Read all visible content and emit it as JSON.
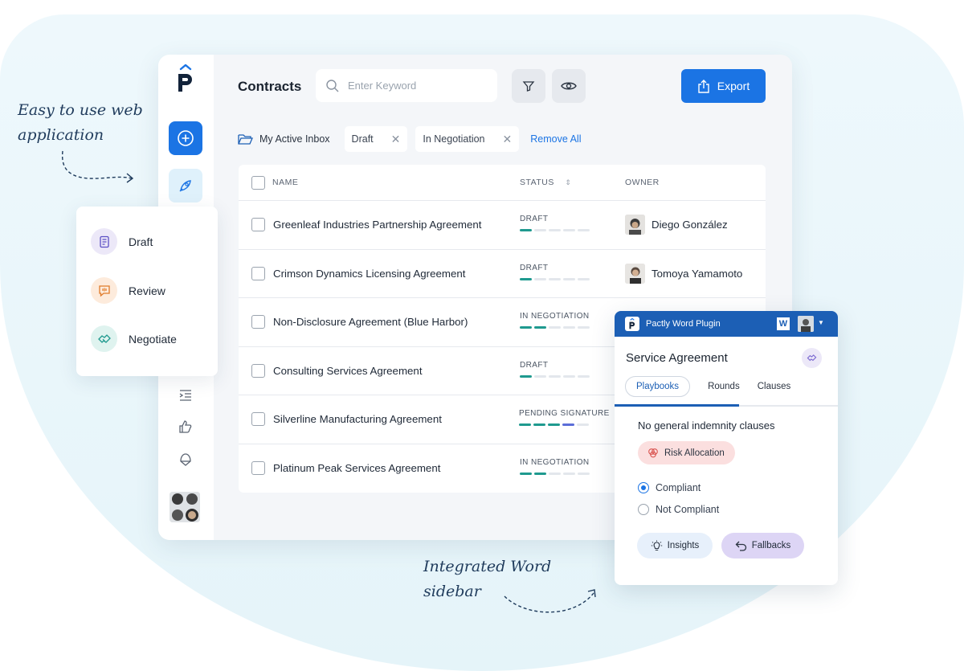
{
  "annotations": {
    "left_line1": "Easy to use web",
    "left_line2": "application",
    "bottom_line1": "Integrated Word",
    "bottom_line2": "sidebar"
  },
  "header": {
    "title": "Contracts",
    "search_placeholder": "Enter Keyword",
    "export_label": "Export"
  },
  "filters": {
    "inbox_label": "My Active Inbox",
    "chips": [
      "Draft",
      "In Negotiation"
    ],
    "remove_all_label": "Remove All"
  },
  "table": {
    "columns": {
      "name": "NAME",
      "status": "STATUS",
      "owner": "OWNER"
    },
    "rows": [
      {
        "name": "Greenleaf Industries Partnership Agreement",
        "status": "DRAFT",
        "progress": 1,
        "owner": "Diego González"
      },
      {
        "name": "Crimson Dynamics Licensing Agreement",
        "status": "DRAFT",
        "progress": 1,
        "owner": "Tomoya Yamamoto"
      },
      {
        "name": "Non-Disclosure Agreement (Blue Harbor)",
        "status": "IN NEGOTIATION",
        "progress": 2,
        "owner": ""
      },
      {
        "name": "Consulting Services Agreement",
        "status": "DRAFT",
        "progress": 1,
        "owner": ""
      },
      {
        "name": "Silverline Manufacturing Agreement",
        "status": "PENDING SIGNATURE",
        "progress": 4,
        "owner": ""
      },
      {
        "name": "Platinum Peak Services Agreement",
        "status": "IN NEGOTIATION",
        "progress": 2,
        "owner": ""
      }
    ]
  },
  "menu": {
    "items": [
      {
        "label": "Draft",
        "icon": "document-icon"
      },
      {
        "label": "Review",
        "icon": "chat-icon"
      },
      {
        "label": "Negotiate",
        "icon": "handshake-icon"
      }
    ]
  },
  "plugin": {
    "header_title": "Pactly Word Plugin",
    "word_badge": "W",
    "doc_title": "Service Agreement",
    "tabs": [
      "Playbooks",
      "Rounds",
      "Clauses"
    ],
    "active_tab": "Playbooks",
    "clause_text": "No general indemnity clauses",
    "risk_label": "Risk Allocation",
    "options": [
      "Compliant",
      "Not Compliant"
    ],
    "selected_option": "Compliant",
    "insights_label": "Insights",
    "fallbacks_label": "Fallbacks"
  },
  "colors": {
    "primary": "#1b74e4",
    "plugin_header": "#1c5fb5",
    "progress_teal": "#1f9a8f",
    "progress_purple": "#5b6dd8",
    "risk_bg": "#fbdfdf",
    "fallbacks_bg": "#ddd5f5",
    "insights_bg": "#e7f0fb"
  }
}
